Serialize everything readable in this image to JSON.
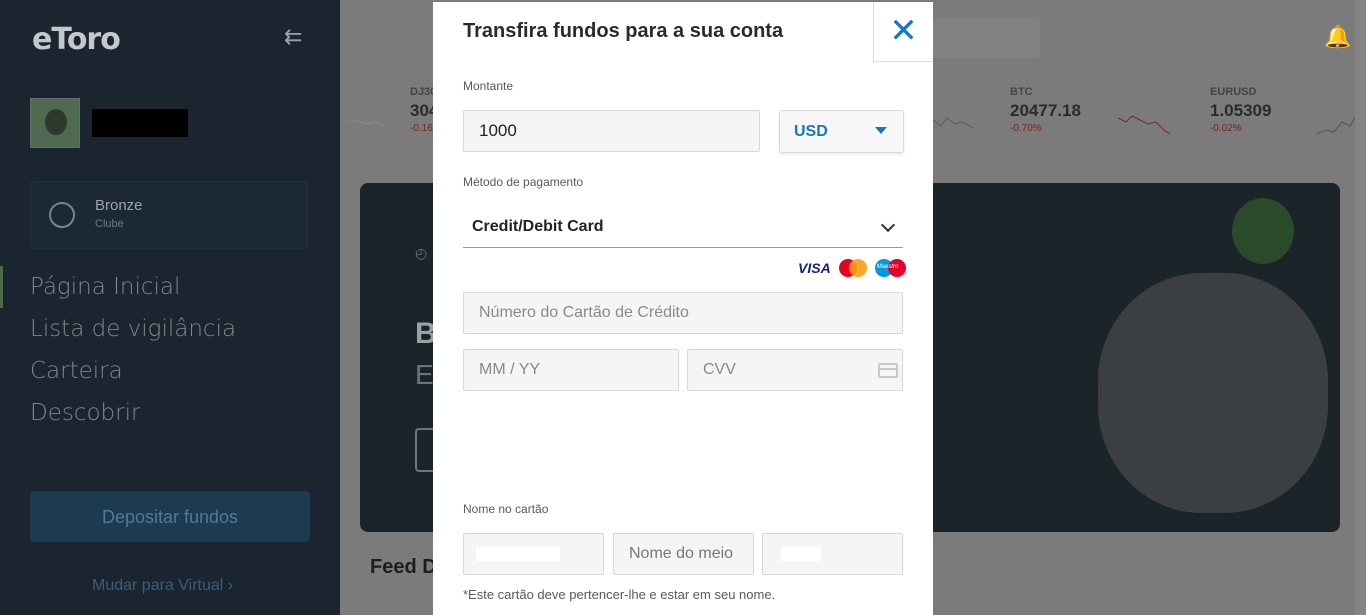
{
  "sidebar": {
    "logo": "eToro",
    "club": {
      "name": "Bronze",
      "label": "Clube"
    },
    "nav": [
      "Página Inicial",
      "Lista de vigilância",
      "Carteira",
      "Descobrir"
    ],
    "deposit_button": "Depositar fundos",
    "virtual_link": "Mudar para Virtual ›"
  },
  "tickers": [
    {
      "symbol": "DJ30",
      "price": "304",
      "change": "-0.16"
    },
    {
      "symbol": "BTC",
      "price": "20477.18",
      "change": "-0.70%"
    },
    {
      "symbol": "EURUSD",
      "price": "1.05309",
      "change": "-0.02%"
    }
  ],
  "main": {
    "feed_title": "Feed D",
    "hero_letter_b": "B",
    "hero_letter_e": "E"
  },
  "modal": {
    "title": "Transfira fundos para a sua conta",
    "close_glyph": "✕",
    "amount_label": "Montante",
    "amount_value": "1000",
    "currency": "USD",
    "method_label": "Método de pagamento",
    "method_value": "Credit/Debit Card",
    "card_brands": [
      "VISA",
      "Maestro"
    ],
    "card_number_placeholder": "Número do Cartão de Crédito",
    "expiry_placeholder": "MM / YY",
    "cvv_placeholder": "CVV",
    "name_label": "Nome no cartão",
    "middle_name_placeholder": "Nome do meio",
    "note": "*Este cartão deve pertencer-lhe e estar em seu nome."
  },
  "colors": {
    "accent": "#1b76bc",
    "sidebar_bg": "#1a2530",
    "overlay": "#7b7b7b"
  }
}
